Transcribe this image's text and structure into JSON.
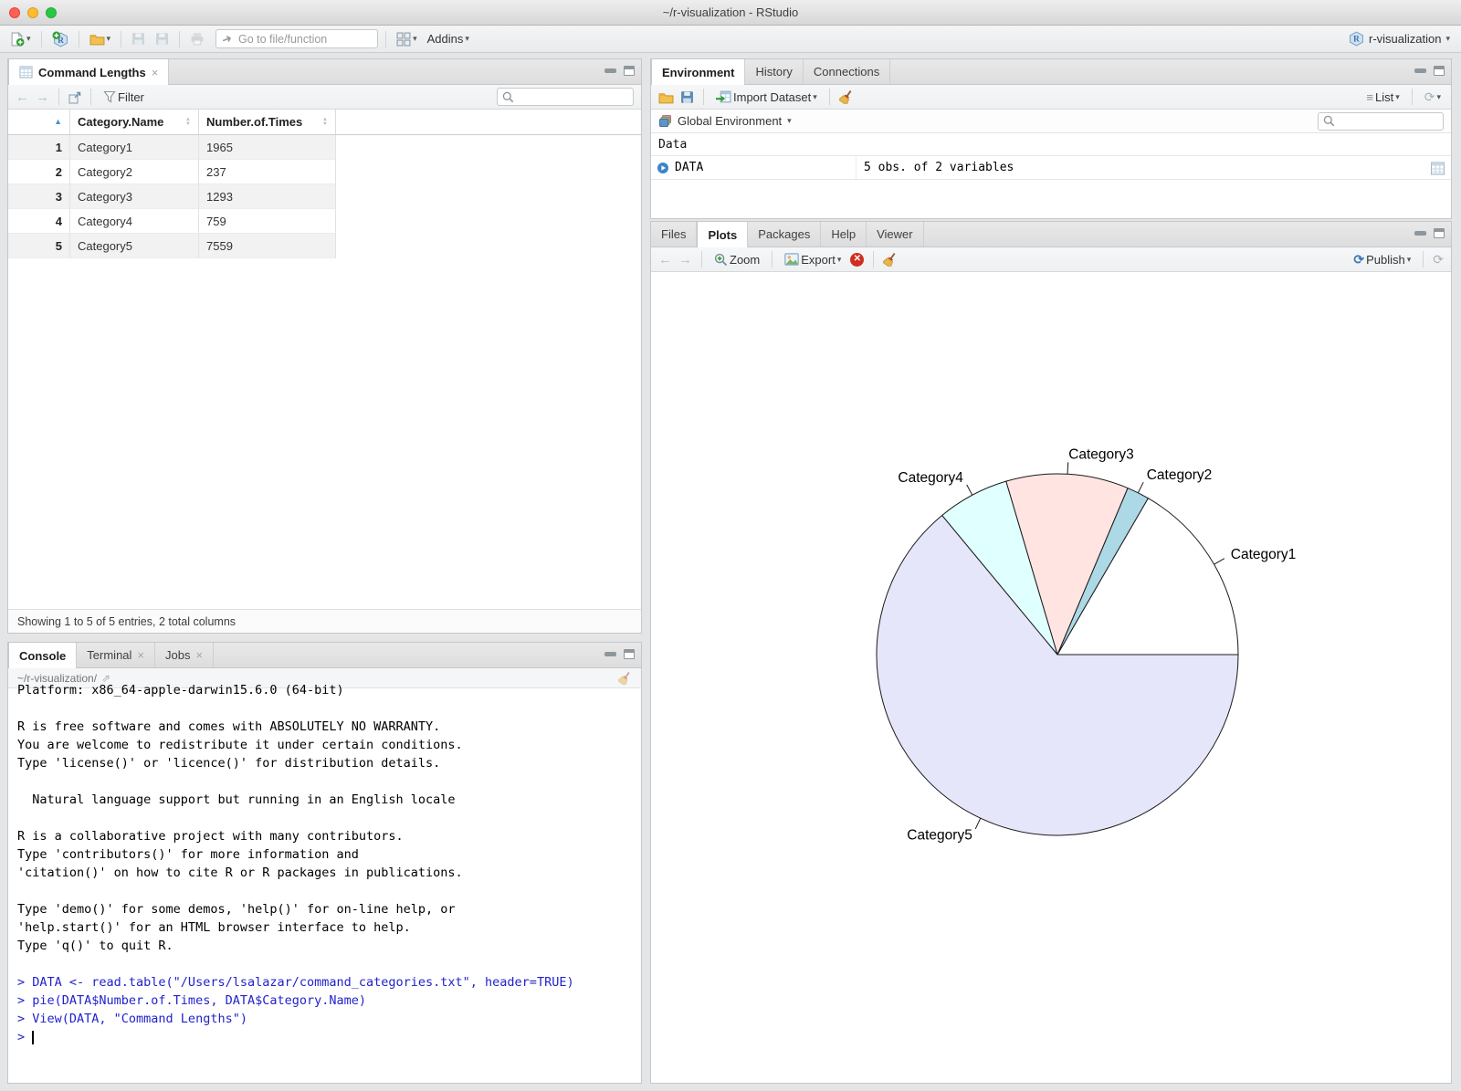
{
  "window": {
    "title": "~/r-visualization - RStudio"
  },
  "toolbar": {
    "goto_placeholder": "Go to file/function",
    "addins_label": "Addins",
    "project_label": "r-visualization"
  },
  "data_viewer": {
    "tab_title": "Command Lengths",
    "filter_label": "Filter",
    "columns": [
      "Category.Name",
      "Number.of.Times"
    ],
    "rows": [
      {
        "n": "1",
        "name": "Category1",
        "times": "1965"
      },
      {
        "n": "2",
        "name": "Category2",
        "times": "237"
      },
      {
        "n": "3",
        "name": "Category3",
        "times": "1293"
      },
      {
        "n": "4",
        "name": "Category4",
        "times": "759"
      },
      {
        "n": "5",
        "name": "Category5",
        "times": "7559"
      }
    ],
    "status": "Showing 1 to 5 of 5 entries, 2 total columns"
  },
  "environment": {
    "tabs": [
      "Environment",
      "History",
      "Connections"
    ],
    "import_label": "Import Dataset",
    "list_label": "List",
    "scope_label": "Global Environment",
    "section_label": "Data",
    "objects": [
      {
        "name": "DATA",
        "value": "5 obs. of 2 variables"
      }
    ]
  },
  "plots": {
    "tabs": [
      "Files",
      "Plots",
      "Packages",
      "Help",
      "Viewer"
    ],
    "zoom_label": "Zoom",
    "export_label": "Export",
    "publish_label": "Publish"
  },
  "console": {
    "tabs": [
      "Console",
      "Terminal",
      "Jobs"
    ],
    "path": "~/r-visualization/",
    "lines": [
      {
        "text": "Platform: x86_64-apple-darwin15.6.0 (64-bit)",
        "type": "output"
      },
      {
        "text": "",
        "type": "output"
      },
      {
        "text": "R is free software and comes with ABSOLUTELY NO WARRANTY.",
        "type": "output"
      },
      {
        "text": "You are welcome to redistribute it under certain conditions.",
        "type": "output"
      },
      {
        "text": "Type 'license()' or 'licence()' for distribution details.",
        "type": "output"
      },
      {
        "text": "",
        "type": "output"
      },
      {
        "text": "  Natural language support but running in an English locale",
        "type": "output"
      },
      {
        "text": "",
        "type": "output"
      },
      {
        "text": "R is a collaborative project with many contributors.",
        "type": "output"
      },
      {
        "text": "Type 'contributors()' for more information and",
        "type": "output"
      },
      {
        "text": "'citation()' on how to cite R or R packages in publications.",
        "type": "output"
      },
      {
        "text": "",
        "type": "output"
      },
      {
        "text": "Type 'demo()' for some demos, 'help()' for on-line help, or",
        "type": "output"
      },
      {
        "text": "'help.start()' for an HTML browser interface to help.",
        "type": "output"
      },
      {
        "text": "Type 'q()' to quit R.",
        "type": "output"
      },
      {
        "text": "",
        "type": "output"
      },
      {
        "text": "> DATA <- read.table(\"/Users/lsalazar/command_categories.txt\", header=TRUE)",
        "type": "input"
      },
      {
        "text": "> pie(DATA$Number.of.Times, DATA$Category.Name)",
        "type": "input"
      },
      {
        "text": "> View(DATA, \"Command Lengths\")",
        "type": "input"
      },
      {
        "text": "> ",
        "type": "input",
        "cursor": true
      }
    ]
  },
  "chart_data": {
    "type": "pie",
    "title": "",
    "categories": [
      "Category1",
      "Category2",
      "Category3",
      "Category4",
      "Category5"
    ],
    "values": [
      1965,
      237,
      1293,
      759,
      7559
    ],
    "colors": [
      "#FFFFFF",
      "#ADD8E6",
      "#FFE4E1",
      "#E0FFFF",
      "#E6E6FA"
    ],
    "start_angle_deg": 0,
    "direction": "counterclockwise",
    "legend": "none",
    "label_style": "outside-with-ticks"
  },
  "colors": {
    "console_input_blue": "#2222cc",
    "traffic_red": "#ff5f57",
    "traffic_yellow": "#febc2e",
    "traffic_green": "#28c840",
    "sort_arrow_blue": "#4a90d9",
    "pie_border": "#000000"
  }
}
